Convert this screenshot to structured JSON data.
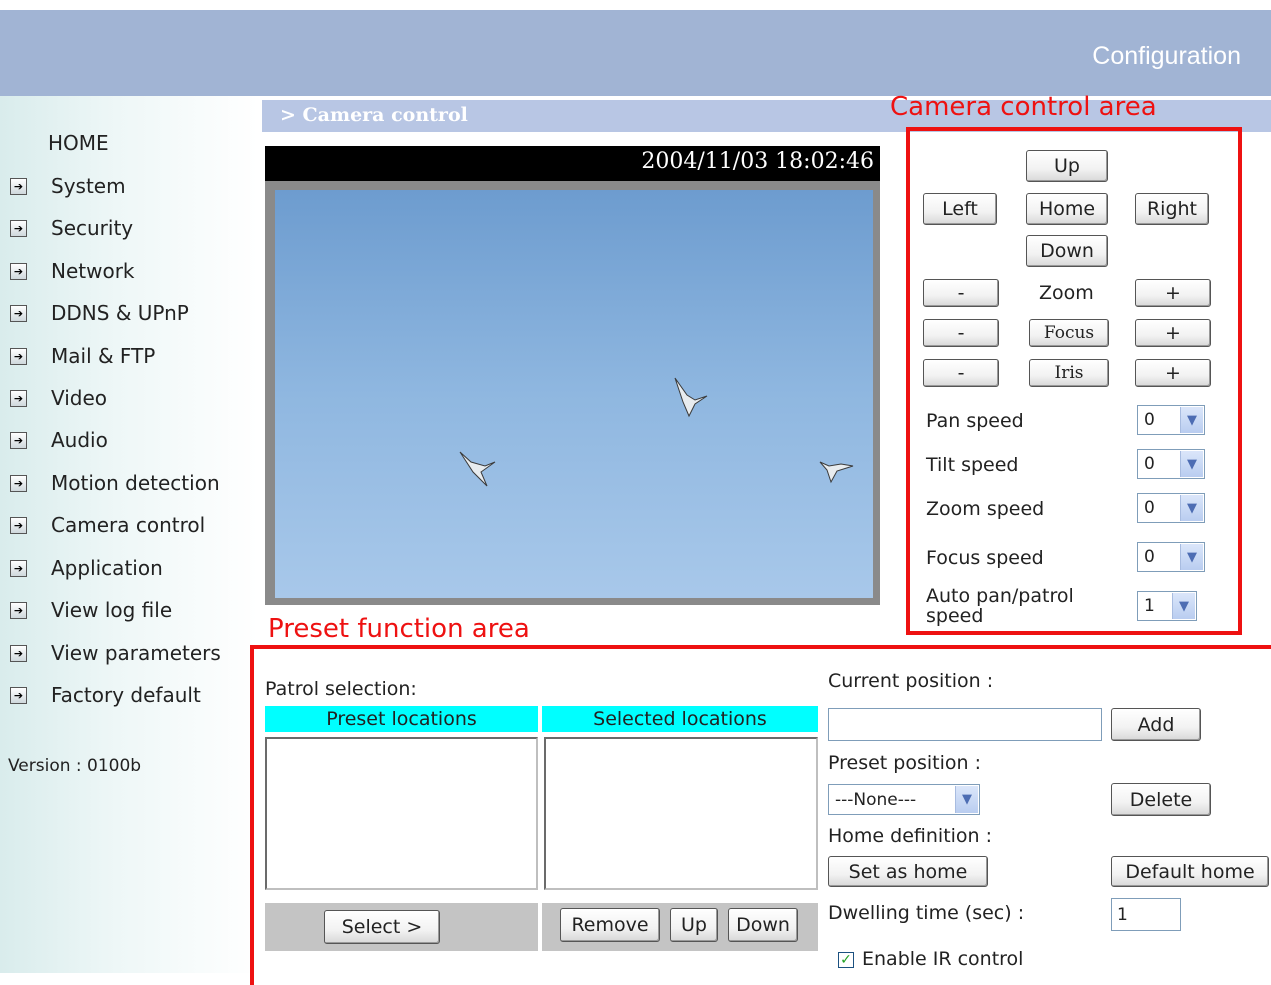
{
  "header": {
    "title": "Configuration"
  },
  "section": {
    "title": "> Camera control"
  },
  "annotations": {
    "camera_area": "Camera control area",
    "preset_area": "Preset function area"
  },
  "sidebar": {
    "home": "HOME",
    "items": [
      {
        "label": "System"
      },
      {
        "label": "Security"
      },
      {
        "label": "Network"
      },
      {
        "label": "DDNS & UPnP"
      },
      {
        "label": "Mail & FTP"
      },
      {
        "label": "Video"
      },
      {
        "label": "Audio"
      },
      {
        "label": "Motion detection"
      },
      {
        "label": "Camera control"
      },
      {
        "label": "Application"
      },
      {
        "label": "View log file"
      },
      {
        "label": "View parameters"
      },
      {
        "label": "Factory default"
      }
    ],
    "version": "Version : 0100b"
  },
  "video": {
    "timestamp": "2004/11/03 18:02:46"
  },
  "camera": {
    "up": "Up",
    "left": "Left",
    "home": "Home",
    "right": "Right",
    "down": "Down",
    "zoom_label": "Zoom",
    "focus_label": "Focus",
    "iris_label": "Iris",
    "minus": "-",
    "plus": "+",
    "speeds": [
      {
        "label": "Pan speed",
        "value": "0"
      },
      {
        "label": "Tilt speed",
        "value": "0"
      },
      {
        "label": "Zoom speed",
        "value": "0"
      },
      {
        "label": "Focus speed",
        "value": "0"
      }
    ],
    "auto_pan_label_1": "Auto pan/patrol",
    "auto_pan_label_2": "speed",
    "auto_pan_value": "1"
  },
  "preset": {
    "patrol_selection": "Patrol selection:",
    "preset_locations": "Preset locations",
    "selected_locations": "Selected locations",
    "select_btn": "Select >",
    "remove_btn": "Remove",
    "up_btn": "Up",
    "down_btn": "Down",
    "current_position": "Current position :",
    "current_position_value": "",
    "add_btn": "Add",
    "preset_position": "Preset position :",
    "preset_position_value": "---None---",
    "delete_btn": "Delete",
    "home_definition": "Home definition :",
    "set_home_btn": "Set as home",
    "default_home_btn": "Default home",
    "dwelling_label": "Dwelling time (sec) :",
    "dwelling_value": "1",
    "enable_ir": "Enable IR control",
    "enable_ir_checked": true
  }
}
